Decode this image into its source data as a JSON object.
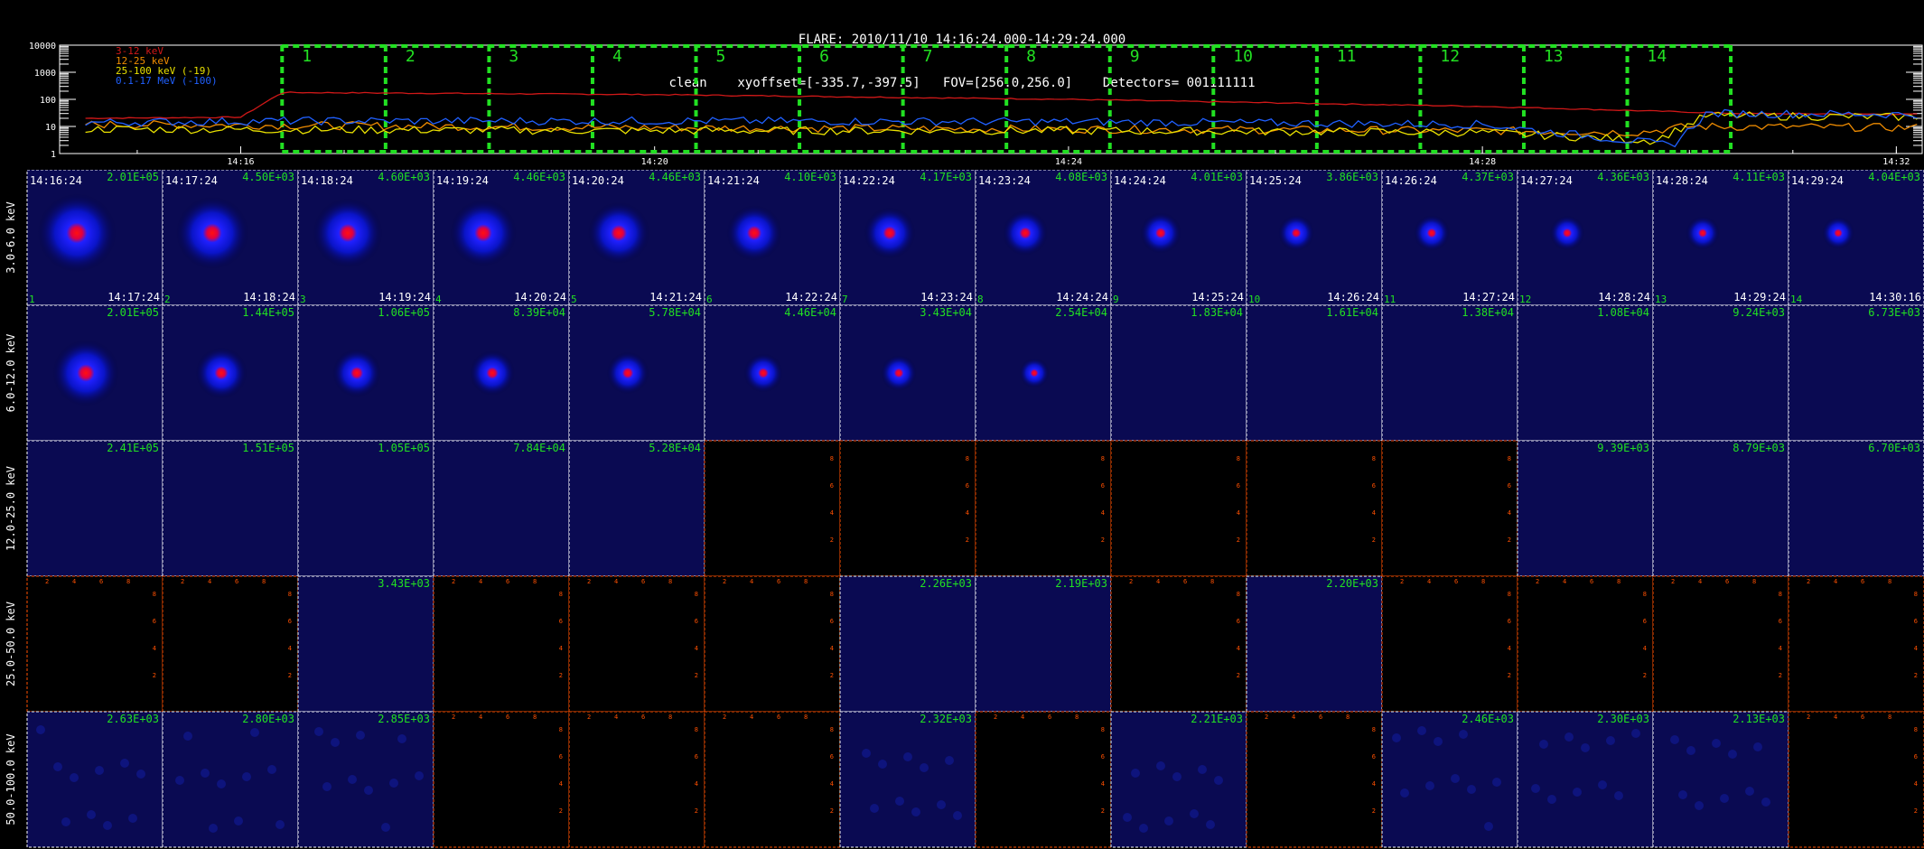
{
  "header": {
    "line1": "FLARE: 2010/11/10 14:16:24.000-14:29:24.000",
    "line2": "clean    xyoffset=[-335.7,-397.5]   FOV=[256.0,256.0]    Detectors= 001111111"
  },
  "chart_data": [
    {
      "type": "line",
      "title": "",
      "yscale": "log",
      "ylim": [
        1,
        10000
      ],
      "y_ticks": [
        "10000",
        "1000",
        "100",
        "10",
        "1"
      ],
      "x_ticks": [
        "14:16",
        "14:20",
        "14:24",
        "14:28",
        "14:32"
      ],
      "xlim_minutes": [
        14.25,
        32.25
      ],
      "legend_position": "top-left",
      "series": [
        {
          "name": "3-12 keV",
          "color": "#d01818",
          "x": [
            "14:14:30",
            "14:16:00",
            "14:16:24",
            "14:20:00",
            "14:24:00",
            "14:28:00",
            "14:30:30",
            "14:32:15"
          ],
          "values": [
            20,
            22,
            180,
            150,
            100,
            55,
            30,
            28
          ]
        },
        {
          "name": "12-25 keV",
          "color": "#f08c00",
          "x": [
            "14:14:30",
            "14:16:24",
            "14:20:00",
            "14:24:00",
            "14:28:00",
            "14:29:30",
            "14:30:00",
            "14:32:15"
          ],
          "values": [
            12,
            11,
            9,
            8,
            7,
            6,
            10,
            9
          ]
        },
        {
          "name": "25-100 keV (-19)",
          "color": "#e8e000",
          "x": [
            "14:14:30",
            "14:20:00",
            "14:24:00",
            "14:28:00",
            "14:29:40",
            "14:30:10",
            "14:32:15"
          ],
          "values": [
            8,
            7,
            7,
            6,
            3,
            25,
            22
          ]
        },
        {
          "name": "0.1-17 MeV (-100)",
          "color": "#2060ff",
          "x": [
            "14:14:30",
            "14:16:24",
            "14:20:00",
            "14:24:00",
            "14:28:00",
            "14:29:50",
            "14:30:10",
            "14:32:15"
          ],
          "values": [
            14,
            16,
            16,
            15,
            12,
            2,
            30,
            28
          ]
        }
      ],
      "time_intervals": [
        "1",
        "2",
        "3",
        "4",
        "5",
        "6",
        "7",
        "8",
        "9",
        "10",
        "11",
        "12",
        "13",
        "14"
      ]
    },
    {
      "type": "heatmap",
      "rows": [
        "3.0-6.0 keV",
        "6.0-12.0 keV",
        "12.0-25.0 keV",
        "25.0-50.0 keV",
        "50.0-100.0 keV"
      ],
      "start_times": [
        "14:16:24",
        "14:17:24",
        "14:18:24",
        "14:19:24",
        "14:20:24",
        "14:21:24",
        "14:22:24",
        "14:23:24",
        "14:24:24",
        "14:25:24",
        "14:26:24",
        "14:27:24",
        "14:28:24",
        "14:29:24"
      ],
      "end_times": [
        "14:17:24",
        "14:18:24",
        "14:19:24",
        "14:20:24",
        "14:21:24",
        "14:22:24",
        "14:23:24",
        "14:24:24",
        "14:25:24",
        "14:26:24",
        "14:27:24",
        "14:28:24",
        "14:29:24",
        "14:30:16"
      ],
      "interval_numbers": [
        "1",
        "2",
        "3",
        "4",
        "5",
        "6",
        "7",
        "8",
        "9",
        "10",
        "11",
        "12",
        "13",
        "14"
      ],
      "peaks": [
        [
          "2.01E+05",
          "4.50E+03",
          "4.60E+03",
          "4.46E+03",
          "4.46E+03",
          "4.10E+03",
          "4.17E+03",
          "4.08E+03",
          "4.01E+03",
          "3.86E+03",
          "4.37E+03",
          "4.36E+03",
          "4.11E+03",
          "4.04E+03"
        ],
        [
          "2.01E+05",
          "1.44E+05",
          "1.06E+05",
          "8.39E+04",
          "5.78E+04",
          "4.46E+04",
          "3.43E+04",
          "2.54E+04",
          "1.83E+04",
          "1.61E+04",
          "1.38E+04",
          "1.08E+04",
          "9.24E+03",
          "6.73E+03"
        ],
        [
          "2.41E+05",
          "1.51E+05",
          "1.05E+05",
          "7.84E+04",
          "5.28E+04",
          "",
          "",
          "",
          "",
          "",
          "",
          "9.39E+03",
          "8.79E+03",
          "6.70E+03"
        ],
        [
          "",
          "",
          "3.43E+03",
          "",
          "",
          "",
          "2.26E+03",
          "2.19E+03",
          "",
          "2.20E+03",
          "",
          "",
          "",
          ""
        ],
        [
          "2.63E+03",
          "2.80E+03",
          "2.85E+03",
          "",
          "",
          "",
          "2.32E+03",
          "",
          "2.21E+03",
          "",
          "2.46E+03",
          "2.30E+03",
          "2.13E+03",
          ""
        ]
      ],
      "blobs": [
        [
          1.0,
          0.9,
          0.85,
          0.8,
          0.72,
          0.62,
          0.55,
          0.45,
          0.38,
          0.3,
          0.3,
          0.28,
          0.26,
          0.24
        ],
        [
          0.8,
          0.55,
          0.5,
          0.45,
          0.4,
          0.35,
          0.3,
          0.2,
          0,
          0,
          0,
          0,
          0,
          0
        ],
        [
          0,
          0,
          0,
          0,
          0,
          0,
          0,
          0,
          0,
          0,
          0,
          0,
          0,
          0
        ],
        [
          0,
          0,
          0,
          0,
          0,
          0,
          0,
          0,
          0,
          0,
          0,
          0,
          0,
          0
        ],
        [
          0,
          0,
          0,
          0,
          0,
          0,
          0,
          0,
          0,
          0,
          0,
          0,
          0,
          0
        ]
      ],
      "empty_panel_ticks": [
        "8",
        "6",
        "4",
        "2"
      ],
      "empty_panel_xticks": [
        "2",
        "4",
        "6",
        "8"
      ]
    }
  ]
}
